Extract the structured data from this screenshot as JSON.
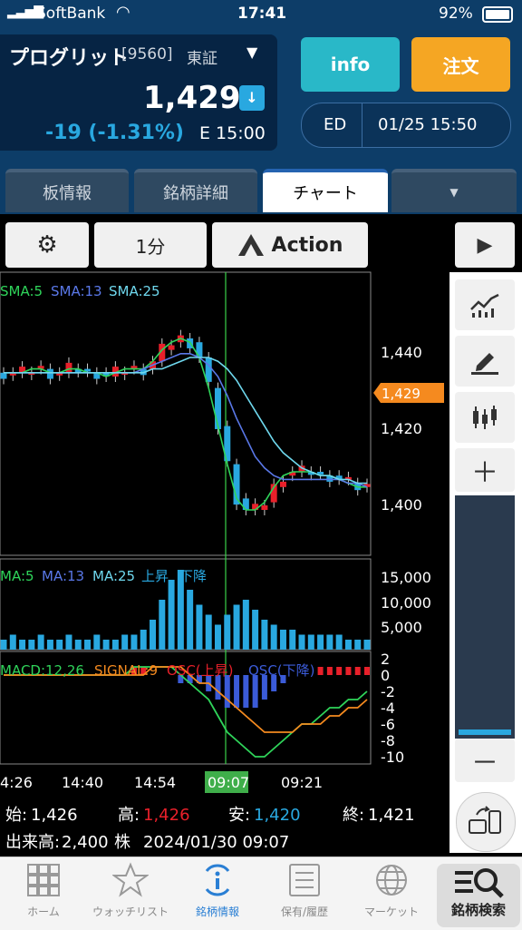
{
  "status": {
    "carrier": "SoftBank",
    "time": "17:41",
    "battery": "92%"
  },
  "stock": {
    "name": "プログリット",
    "code": "[9560]",
    "market": "東証",
    "price": "1,429",
    "change": "-19 (-1.31%)",
    "price_time": "E 15:00"
  },
  "header_buttons": {
    "info": "info",
    "order": "注文",
    "ed": "ED",
    "ed_time": "01/25 15:50"
  },
  "tabs": [
    "板情報",
    "銘柄詳細",
    "チャート"
  ],
  "toolbar": {
    "interval": "1分",
    "action": "Action"
  },
  "legends": {
    "price": [
      "SMA:5",
      "SMA:13",
      "SMA:25"
    ],
    "volume": [
      "MA:5",
      "MA:13",
      "MA:25",
      "上昇",
      "下降"
    ],
    "macd": [
      "MACD:12,26",
      "SIGNAL:9",
      "OSC(上昇)",
      "OSC(下降)"
    ]
  },
  "price_axis": [
    "1,440",
    "1,420",
    "1,400"
  ],
  "current_price_tag": "1,429",
  "volume_axis": [
    "15,000",
    "10,000",
    "5,000"
  ],
  "macd_axis": [
    "2",
    "0",
    "-2",
    "-4",
    "-6",
    "-8",
    "-10"
  ],
  "time_axis": [
    "4:26",
    "14:40",
    "14:54",
    "09:07",
    "09:21"
  ],
  "ohlc": {
    "open_label": "始:",
    "open": "1,426",
    "high_label": "高:",
    "high": "1,426",
    "low_label": "安:",
    "low": "1,420",
    "close_label": "終:",
    "close": "1,421",
    "volume_label": "出来高:",
    "volume": "2,400",
    "volume_unit": "株",
    "datetime": "2024/01/30 09:07"
  },
  "bottom_nav": [
    "ホーム",
    "ウォッチリスト",
    "銘柄情報",
    "保有/履歴",
    "マーケット",
    "銘柄検索"
  ],
  "colors": {
    "header": "#0d3d68",
    "up": "#e8202a",
    "down": "#29a8e0",
    "sma5": "#2fd45a",
    "sma13": "#5a78e8",
    "sma25": "#6fd8ee",
    "order": "#f5a623",
    "info": "#29b8c8"
  },
  "chart_data": {
    "type": "line",
    "ylim": [
      1390,
      1453
    ],
    "series": [
      {
        "name": "SMA:5",
        "values": [
          1436,
          1436,
          1436,
          1437,
          1437,
          1436,
          1436,
          1437,
          1437,
          1436,
          1436,
          1435,
          1436,
          1437,
          1437,
          1437,
          1439,
          1442,
          1444,
          1445,
          1444,
          1440,
          1432,
          1422,
          1412,
          1403,
          1400,
          1400,
          1402,
          1406,
          1409,
          1410,
          1410,
          1410,
          1409,
          1409,
          1408,
          1407,
          1406,
          1406
        ]
      },
      {
        "name": "SMA:13",
        "values": [
          1436,
          1436,
          1436,
          1436,
          1436,
          1436,
          1436,
          1436,
          1436,
          1436,
          1436,
          1436,
          1436,
          1436,
          1436,
          1437,
          1438,
          1439,
          1440,
          1441,
          1441,
          1440,
          1438,
          1435,
          1430,
          1424,
          1419,
          1414,
          1411,
          1409,
          1408,
          1408,
          1408,
          1408,
          1408,
          1408,
          1408,
          1407,
          1407,
          1406
        ]
      },
      {
        "name": "SMA:25",
        "values": [
          1436,
          1436,
          1436,
          1436,
          1436,
          1436,
          1436,
          1436,
          1436,
          1436,
          1436,
          1436,
          1436,
          1436,
          1436,
          1436,
          1437,
          1437,
          1438,
          1439,
          1440,
          1440,
          1440,
          1439,
          1437,
          1434,
          1430,
          1426,
          1422,
          1418,
          1415,
          1413,
          1411,
          1410,
          1409,
          1409,
          1408,
          1408,
          1407,
          1407
        ]
      }
    ]
  }
}
